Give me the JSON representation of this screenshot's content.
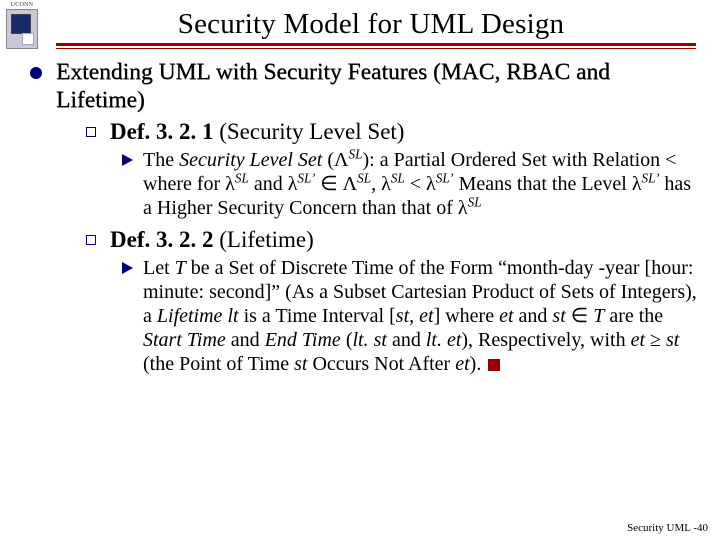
{
  "logo_text": "UCONN",
  "title": "Security Model for UML Design",
  "lvl1": "Extending UML with Security Features (MAC, RBAC and Lifetime)",
  "def1": {
    "label": "Def. 3. 2. 1",
    "name": "(Security Level Set)"
  },
  "def1_body_a": "The ",
  "def1_body_b": "Security Level Set",
  "def1_body_c": " (Λ",
  "def1_body_d": "): a Partial Ordered Set with Relation < where for λ",
  "def1_body_e": " and λ",
  "def1_body_f": " ∈ Λ",
  "def1_body_g": ", λ",
  "def1_body_h": " < λ",
  "def1_body_i": " Means that the Level λ",
  "def1_body_j": " has a Higher Security Concern than that of λ",
  "def2": {
    "label": "Def. 3. 2. 2",
    "name": "(Lifetime)"
  },
  "def2_a": "Let ",
  "def2_T": "T",
  "def2_b": " be a Set of Discrete Time of the Form “month-day -year [hour: minute: second]” (As a Subset Cartesian Product of Sets of Integers), a ",
  "def2_lt": "Lifetime lt",
  "def2_c": " is a Time Interval [",
  "def2_st": "st",
  "def2_d": ", ",
  "def2_et": "et",
  "def2_e": "] where ",
  "def2_f": " and ",
  "def2_g": " ∈ ",
  "def2_h": " are the ",
  "def2_start": "Start Time ",
  "def2_i": "and ",
  "def2_end": "End Time",
  "def2_j": " (",
  "def2_ltst": "lt. st",
  "def2_k": " and ",
  "def2_ltet": "lt. et",
  "def2_l": "), Respectively, with ",
  "def2_m": " ≥ ",
  "def2_n": " (the Point of Time ",
  "def2_o": " Occurs Not After ",
  "def2_p": "). ",
  "sup_SL": "SL",
  "sup_SLp": "SL’",
  "footer": "Security UML -40"
}
